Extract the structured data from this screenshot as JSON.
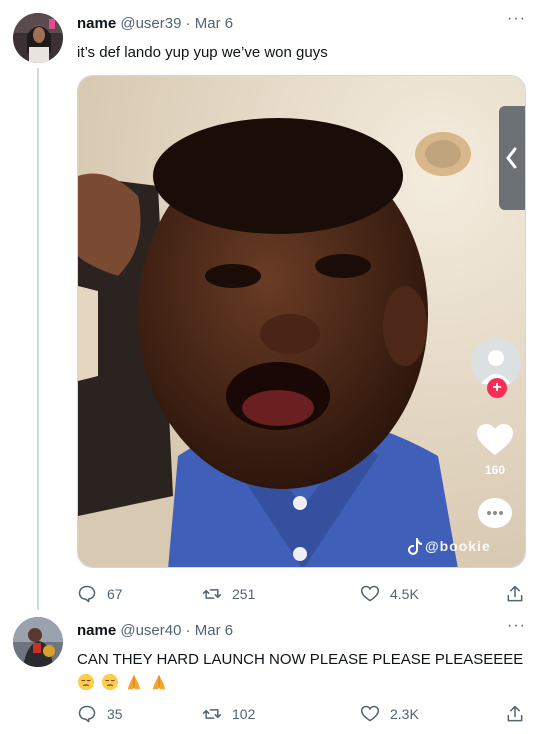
{
  "tweets": [
    {
      "name": "name",
      "handle": "@user39",
      "separator": "·",
      "date": "Mar 6",
      "text": "it’s def lando yup yup we’ve won guys",
      "counts": {
        "replies": "67",
        "retweets": "251",
        "likes": "4.5K"
      }
    },
    {
      "name": "name",
      "handle": "@user40",
      "separator": "·",
      "date": "Mar 6",
      "text": "CAN THEY HARD LAUNCH NOW PLEASE PLEASE PLEASEEEE",
      "emoji": [
        "pensive-face",
        "pensive-face",
        "folded-hands",
        "folded-hands"
      ],
      "counts": {
        "replies": "35",
        "retweets": "102",
        "likes": "2.3K"
      }
    }
  ],
  "video_overlay": {
    "like_count": "160",
    "watermark": "@bookie"
  },
  "more_label": "···",
  "colors": {
    "text": "#0f1419",
    "secondary": "#536471",
    "border": "#cfd9de",
    "tiktok_red": "#fe2c55"
  }
}
